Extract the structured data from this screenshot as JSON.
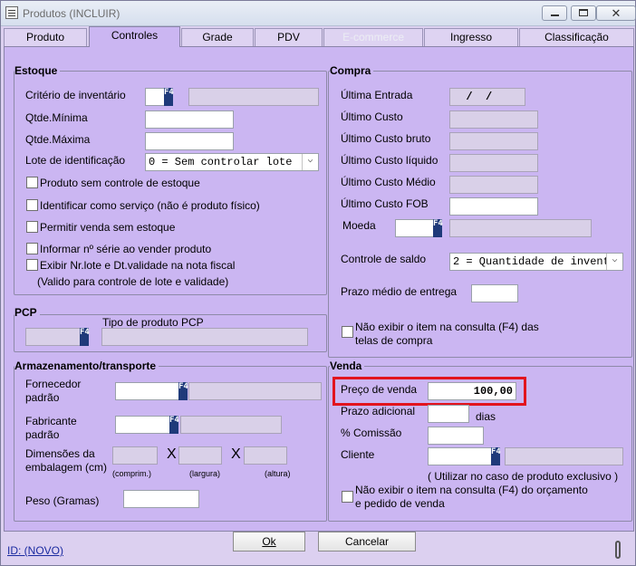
{
  "window": {
    "title": "Produtos (INCLUIR)"
  },
  "tabs": [
    {
      "label": "Produto"
    },
    {
      "label": "Controles"
    },
    {
      "label": "Grade"
    },
    {
      "label": "PDV"
    },
    {
      "label": "E-commerce"
    },
    {
      "label": "Ingresso"
    },
    {
      "label": "Classificação"
    }
  ],
  "estoque": {
    "title": "Estoque",
    "criterio_label": "Critério de inventário",
    "qtde_min_label": "Qtde.Mínima",
    "qtde_max_label": "Qtde.Máxima",
    "lote_label": "Lote de identificação",
    "lote_value": "0 = Sem controlar lote",
    "chk1": "Produto sem controle de estoque",
    "chk2": "Identificar como serviço (não é produto físico)",
    "chk3": "Permitir venda sem estoque",
    "chk4": "Informar nº série ao vender produto",
    "chk5": "Exibir Nr.lote e Dt.validade na nota fiscal",
    "chk5_note": "(Valido para controle de lote e validade)"
  },
  "pcp": {
    "title": "PCP",
    "tipo_label": "Tipo de produto PCP"
  },
  "armazenamento": {
    "title": "Armazenamento/transporte",
    "fornecedor_l1": "Fornecedor",
    "fornecedor_l2": "padrão",
    "fabricante_l1": "Fabricante",
    "fabricante_l2": "padrão",
    "dim_l1": "Dimensões da",
    "dim_l2": "embalagem (cm)",
    "x": "X",
    "comprim": "(comprim.)",
    "largura": "(largura)",
    "altura": "(altura)",
    "peso_label": "Peso (Gramas)"
  },
  "compra": {
    "title": "Compra",
    "ultima_entrada_label": "Última Entrada",
    "ultima_entrada_value": "  /  /",
    "ultimo_custo": "Último Custo",
    "ultimo_custo_bruto": "Último Custo bruto",
    "ultimo_custo_liquido": "Último Custo líquido",
    "ultimo_custo_medio": "Último Custo Médio",
    "ultimo_custo_fob": "Último Custo FOB",
    "moeda": "Moeda",
    "controle_saldo_label": "Controle de saldo",
    "controle_saldo_value": "2 = Quantidade de invent",
    "prazo_medio": "Prazo médio de entrega",
    "nao_exibir_l1": "Não exibir o item na consulta (F4) das",
    "nao_exibir_l2": "telas de compra"
  },
  "venda": {
    "title": "Venda",
    "preco_label": "Preço de venda",
    "preco_value": "100,00",
    "prazo_adicional": "Prazo adicional",
    "dias": "dias",
    "comissao": "% Comissão",
    "cliente": "Cliente",
    "cliente_note": "( Utilizar no caso de produto exclusivo )",
    "nao_exibir_l1": "Não exibir o item na consulta (F4) do orçamento",
    "nao_exibir_l2": "e pedido de venda"
  },
  "footer": {
    "id_link": "ID: (NOVO)",
    "ok": "Ok",
    "cancel": "Cancelar"
  },
  "f4_label": "F4",
  "colors": {
    "accent": "#cbb6f2",
    "highlight": "#e2141e",
    "f4": "#1f3a7a"
  }
}
